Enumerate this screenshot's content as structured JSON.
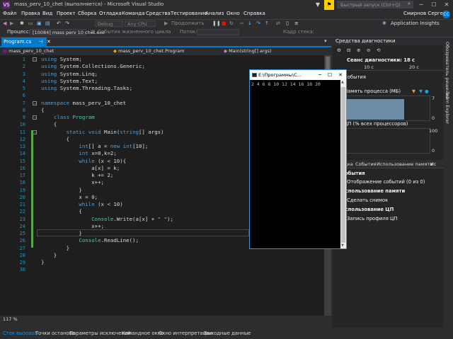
{
  "titlebar": {
    "title": "mass_perv_10_chet (выполняется) - Microsoft Visual Studio",
    "quick_launch_placeholder": "Быстрый запуск (Ctrl+Q)",
    "vs_logo": "VS"
  },
  "menu": {
    "items": [
      "Файл",
      "Правка",
      "Вид",
      "Проект",
      "Сборка",
      "Отладка",
      "Команда",
      "Средства",
      "Тестирование",
      "Анализ",
      "Окно",
      "Справка"
    ],
    "user": "Смирнов Сергей",
    "avatar": "СС"
  },
  "toolbar": {
    "debug_config": "Debug",
    "platform": "Any CPU",
    "continue_label": "Продолжить",
    "application_insights": "Application Insights"
  },
  "toolbar2": {
    "process_label": "Процесс:",
    "process_value": "[10084] mass perv 10 chet.exe",
    "lifecycle_label": "События жизненного цикла",
    "thread_label": "Поток:",
    "stack_frame_label": "Кадр стека:"
  },
  "tabs": {
    "active_file": "Program.cs",
    "nav_project": "mass_perv_10_chet",
    "nav_class": "mass_perv_10_chet.Program",
    "nav_member": "Main(string[] args)"
  },
  "editor": {
    "zoom": "117 %",
    "lines": [
      {
        "n": "1",
        "html": "<span class=\"kw\">using</span> System;"
      },
      {
        "n": "2",
        "html": "<span class=\"kw\">using</span> System.Collections.Generic;"
      },
      {
        "n": "3",
        "html": "<span class=\"kw\">using</span> System.Linq;"
      },
      {
        "n": "4",
        "html": "<span class=\"kw\">using</span> System.Text;"
      },
      {
        "n": "5",
        "html": "<span class=\"kw\">using</span> System.Threading.Tasks;"
      },
      {
        "n": "6",
        "html": ""
      },
      {
        "n": "7",
        "html": "<span class=\"kw\">namespace</span> mass_perv_10_chet"
      },
      {
        "n": "8",
        "html": "{"
      },
      {
        "n": "9",
        "html": "    <span class=\"kw\">class</span> <span class=\"ty\">Program</span>"
      },
      {
        "n": "10",
        "html": "    {"
      },
      {
        "n": "11",
        "html": "        <span class=\"kw\">static</span> <span class=\"kw\">void</span> Main(<span class=\"kw\">string</span>[] args)"
      },
      {
        "n": "12",
        "html": "        {"
      },
      {
        "n": "13",
        "html": "            <span class=\"kw\">int</span>[] a = <span class=\"kw\">new</span> <span class=\"kw\">int</span>[10];"
      },
      {
        "n": "14",
        "html": "            <span class=\"kw\">int</span> x=0,k=2;"
      },
      {
        "n": "15",
        "html": "            <span class=\"kw\">while</span> (x &lt; 10){"
      },
      {
        "n": "16",
        "html": "                a[x] = k;"
      },
      {
        "n": "17",
        "html": "                k += 2;"
      },
      {
        "n": "18",
        "html": "                x++;"
      },
      {
        "n": "19",
        "html": "            }"
      },
      {
        "n": "20",
        "html": "            x = 0;"
      },
      {
        "n": "21",
        "html": "            <span class=\"kw\">while</span> (x &lt; 10)"
      },
      {
        "n": "22",
        "html": "            {"
      },
      {
        "n": "23",
        "html": "                <span class=\"ty\">Console</span>.Write(a[x] + <span class=\"str\">\" \"</span>);"
      },
      {
        "n": "24",
        "html": "                x++;"
      },
      {
        "n": "25",
        "html": "            }"
      },
      {
        "n": "26",
        "html": "            <span class=\"ty\">Console</span>.ReadLine();"
      },
      {
        "n": "27",
        "html": "        }"
      },
      {
        "n": "28",
        "html": "    }"
      },
      {
        "n": "29",
        "html": "}"
      },
      {
        "n": "30",
        "html": ""
      }
    ]
  },
  "console": {
    "title": "E:\\Программы\\C...",
    "output": "2 4 6 8 10 12 14 16 18 20"
  },
  "diagnostics": {
    "title": "Средства диагностики",
    "session": "Сеанс диагностики: 18 с",
    "tick_10": "10 с",
    "tick_20": "20 с",
    "events": "События",
    "memory": "Память процесса (МБ)",
    "mem_max": "7",
    "mem_min": "0",
    "cpu": "ЦП (% всех процессоров)",
    "cpu_max": "100",
    "cpu_min": "0",
    "tabs": [
      "Сводка",
      "События",
      "Использование памяти",
      "Ис"
    ],
    "sec_events": "События",
    "events_show": "Отображение событий (0 из 0)",
    "sec_memory": "Использование памяти",
    "snapshot": "Сделать снимок",
    "sec_cpu": "Использование ЦП",
    "cpu_profile": "Запись профиля ЦП"
  },
  "right_strip": {
    "solution_explorer": "Обозреватель решений",
    "team_explorer": "Team Explorer"
  },
  "bottom_tabs": [
    "Стек вызовов",
    "Точки останова",
    "Параметры исключений",
    "Командное окно",
    "Окно интерпретации",
    "Выходные данные"
  ]
}
